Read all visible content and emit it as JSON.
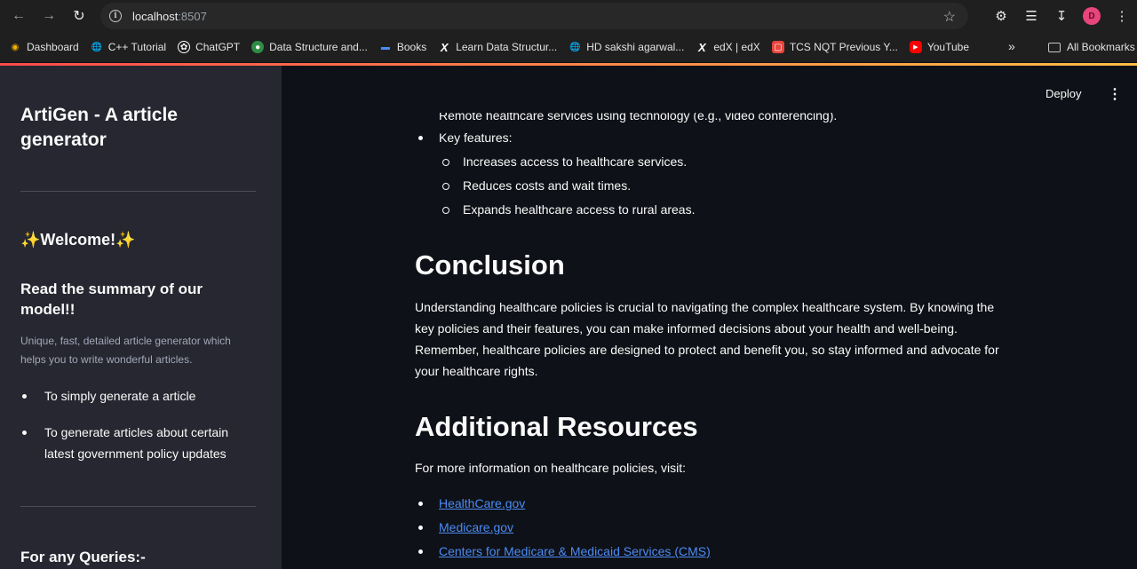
{
  "browser": {
    "url_host": "localhost",
    "url_port": ":8507",
    "avatar_letter": "D",
    "bookmarks": [
      {
        "label": "Dashboard",
        "icon": "dashboard-icon"
      },
      {
        "label": "C++ Tutorial",
        "icon": "globe-icon"
      },
      {
        "label": "ChatGPT",
        "icon": "chatgpt-icon"
      },
      {
        "label": "Data Structure and...",
        "icon": "leaf-icon"
      },
      {
        "label": "Books",
        "icon": "books-icon"
      },
      {
        "label": "Learn Data Structur...",
        "icon": "x-icon"
      },
      {
        "label": "HD sakshi agarwal...",
        "icon": "globe-icon"
      },
      {
        "label": "edX | edX",
        "icon": "x-icon"
      },
      {
        "label": "TCS NQT Previous Y...",
        "icon": "tcs-icon"
      },
      {
        "label": "YouTube",
        "icon": "youtube-icon"
      }
    ],
    "all_bookmarks": "All Bookmarks"
  },
  "sidebar": {
    "title": "ArtiGen - A article generator",
    "welcome": "✨Welcome!✨",
    "subtitle": "Read the summary of our model!!",
    "description": "Unique, fast, detailed article generator which helps you to write wonderful articles.",
    "items": [
      "To simply generate a article",
      "To generate articles about certain latest government policy updates"
    ],
    "queries": "For any Queries:-"
  },
  "header": {
    "deploy": "Deploy"
  },
  "article": {
    "partial_line": "Remote healthcare services using technology (e.g., video conferencing).",
    "key_features": "Key features:",
    "features": [
      "Increases access to healthcare services.",
      "Reduces costs and wait times.",
      "Expands healthcare access to rural areas."
    ],
    "conclusion_heading": "Conclusion",
    "conclusion_lines": [
      "Understanding healthcare policies is crucial to navigating the complex healthcare system. By knowing the",
      "key policies and their features, you can make informed decisions about your health and well-being.",
      "Remember, healthcare policies are designed to protect and benefit you, so stay informed and advocate for",
      "your healthcare rights."
    ],
    "resources_heading": "Additional Resources",
    "resources_intro": "For more information on healthcare policies, visit:",
    "links": [
      "HealthCare.gov",
      "Medicare.gov",
      "Centers for Medicare & Medicaid Services (CMS)"
    ]
  },
  "colors": {
    "sidebar_bg": "#262730",
    "main_bg": "#0e1117",
    "link": "#4c8bf5",
    "accent": "#ff4b4b"
  }
}
